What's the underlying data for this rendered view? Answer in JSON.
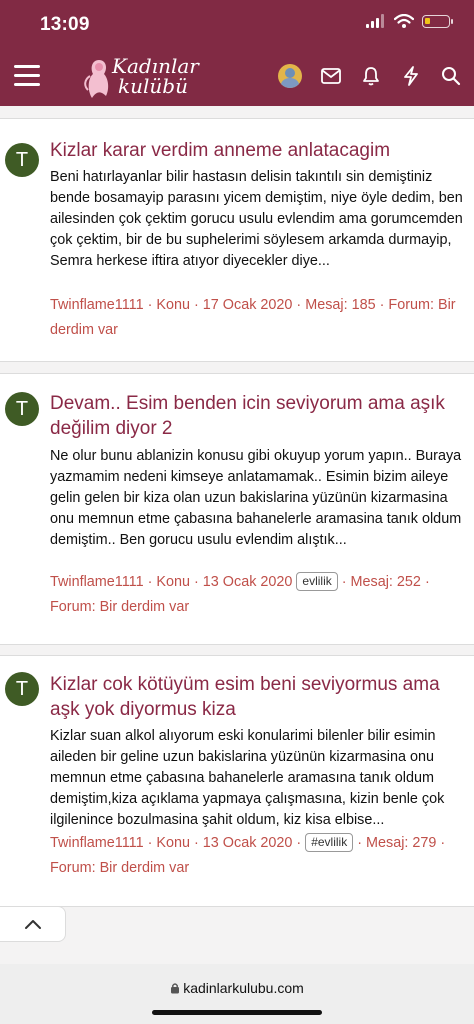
{
  "status_bar": {
    "time": "13:09",
    "battery_color": "#f0c419"
  },
  "header": {
    "bg_color": "#812a44",
    "logo_line1": "Kadınlar",
    "logo_line2": "kulübü",
    "menu_icon": "hamburger-menu-icon",
    "nav_icons": [
      "avatar",
      "envelope-icon",
      "bell-icon",
      "lightning-icon",
      "search-icon"
    ]
  },
  "results": [
    {
      "avatar_letter": "T",
      "title": "Kizlar karar verdim anneme anlatacagim",
      "snippet": "Beni hatırlayanlar bilir hastasın delisin takıntılı sin demiştiniz bende bosamayip parasını yicem demiştim, niye öyle dedim, ben ailesinden çok çektim gorucu usulu evlendim ama gorumcemden çok çektim, bir de bu suphelerimi söylesem arkamda durmayip, Semra herkese iftira atıyor diyecekler diye...",
      "author": "Twinflame1111",
      "type": "Konu",
      "date": "17 Ocak 2020",
      "tag": "",
      "replies": "Mesaj: 185",
      "forum": "Forum: Bir derdim var"
    },
    {
      "avatar_letter": "T",
      "title": "Devam.. Esim benden icin seviyorum ama aşık değilim diyor 2",
      "snippet": "Ne olur bunu ablanizin konusu gibi okuyup yorum yapın.. Buraya yazmamim nedeni kimseye anlatamamak.. Esimin bizim aileye gelin gelen bir kiza olan uzun bakislarina yüzünün kizarmasina onu memnun etme çabasına bahanelerle aramasina tanık oldum demiştim.. Ben gorucu usulu evlendim alıştık...",
      "author": "Twinflame1111",
      "type": "Konu",
      "date": "13 Ocak 2020",
      "tag": "evlilik",
      "replies": "Mesaj: 252",
      "forum": "Forum: Bir derdim var"
    },
    {
      "avatar_letter": "T",
      "title": "Kizlar cok kötüyüm esim beni seviyormus ama aşk yok diyormus kiza",
      "snippet": "Kizlar suan alkol alıyorum eski konularimi bilenler bilir esimin aileden bir geline uzun bakislarina yüzünün kizarmasina onu memnun etme çabasına bahanelerle aramasına tanık oldum demiştim,kiza açıklama yapmaya çalışmasına, kizin benle çok ilgilenince bozulmasina şahit oldum, kiz kisa elbise...",
      "author": "Twinflame1111",
      "type": "Konu",
      "date": "13 Ocak 2020",
      "tag": "#evlilik",
      "replies": "Mesaj: 279",
      "forum": "Forum: Bir derdim var"
    }
  ],
  "bottom_tab_icon": "chevron-up-icon",
  "browser": {
    "url": "kadinlarkulubu.com",
    "lock_icon": "lock-icon"
  }
}
